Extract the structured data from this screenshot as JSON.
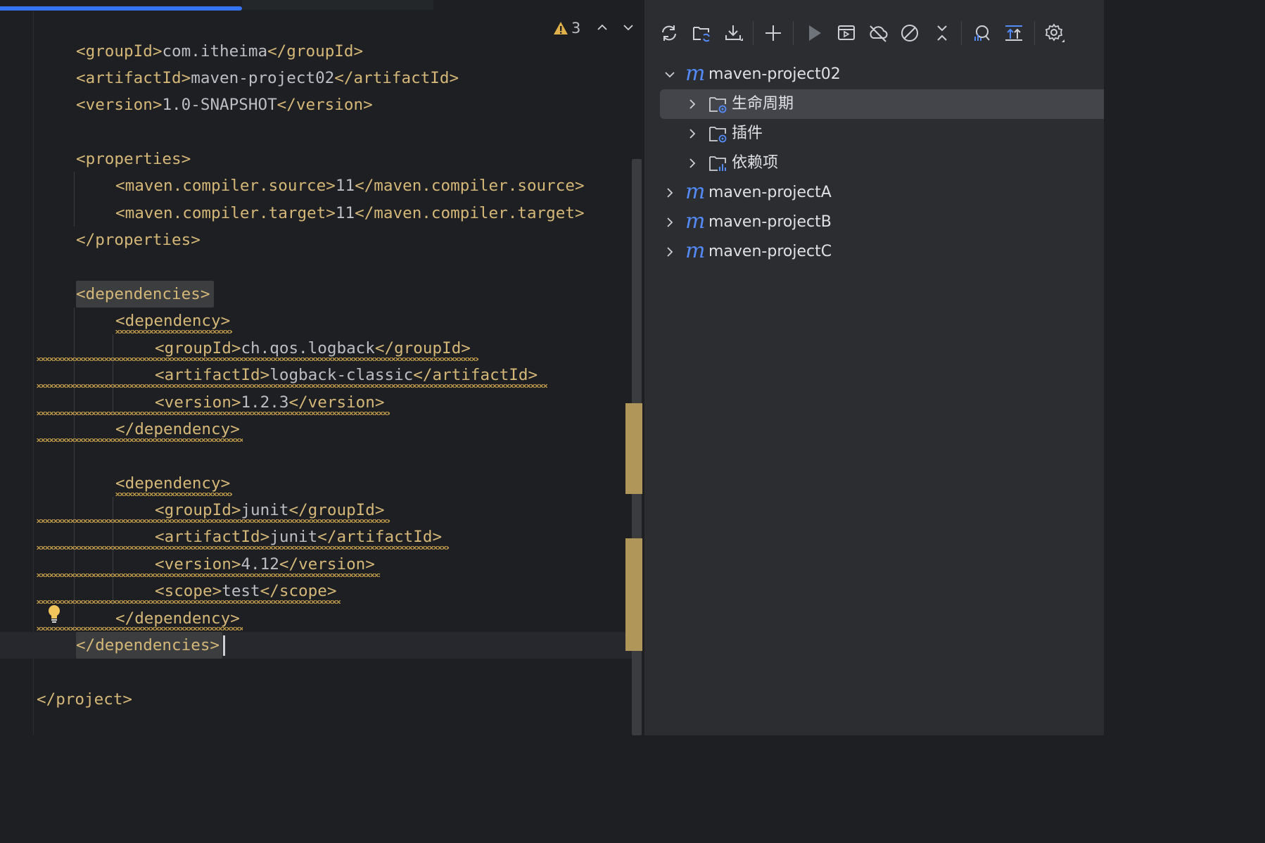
{
  "editor": {
    "lines": [
      {
        "id": "l1",
        "parts": [
          [
            "tag",
            "<groupId>"
          ],
          [
            "txt",
            "com.itheima"
          ],
          [
            "tag",
            "</groupId>"
          ]
        ]
      },
      {
        "id": "l2",
        "parts": [
          [
            "tag",
            "<artifactId>"
          ],
          [
            "txt",
            "maven-project02"
          ],
          [
            "tag",
            "</artifactId>"
          ]
        ]
      },
      {
        "id": "l3",
        "parts": [
          [
            "tag",
            "<version>"
          ],
          [
            "txt",
            "1.0-SNAPSHOT"
          ],
          [
            "tag",
            "</version>"
          ]
        ]
      },
      {
        "id": "l5",
        "parts": [
          [
            "tag",
            "<properties>"
          ]
        ]
      },
      {
        "id": "l6",
        "parts": [
          [
            "tag",
            "<maven.compiler.source>"
          ],
          [
            "txt",
            "11"
          ],
          [
            "tag",
            "</maven.compiler.source>"
          ]
        ]
      },
      {
        "id": "l7",
        "parts": [
          [
            "tag",
            "<maven.compiler.target>"
          ],
          [
            "txt",
            "11"
          ],
          [
            "tag",
            "</maven.compiler.target>"
          ]
        ]
      },
      {
        "id": "l8",
        "parts": [
          [
            "tag",
            "</properties>"
          ]
        ]
      },
      {
        "id": "l10",
        "parts": [
          [
            "tag",
            "<dependencies>"
          ]
        ]
      },
      {
        "id": "l11",
        "parts": [
          [
            "tag",
            "<dependency>"
          ]
        ]
      },
      {
        "id": "l12",
        "parts": [
          [
            "tag",
            "<groupId>"
          ],
          [
            "txt",
            "ch.qos.logback"
          ],
          [
            "tag",
            "</groupId>"
          ]
        ]
      },
      {
        "id": "l13",
        "parts": [
          [
            "tag",
            "<artifactId>"
          ],
          [
            "txt",
            "logback-classic"
          ],
          [
            "tag",
            "</artifactId>"
          ]
        ]
      },
      {
        "id": "l14",
        "parts": [
          [
            "tag",
            "<version>"
          ],
          [
            "txt",
            "1.2.3"
          ],
          [
            "tag",
            "</version>"
          ]
        ]
      },
      {
        "id": "l15",
        "parts": [
          [
            "tag",
            "</dependency>"
          ]
        ]
      },
      {
        "id": "l17",
        "parts": [
          [
            "tag",
            "<dependency>"
          ]
        ]
      },
      {
        "id": "l18",
        "parts": [
          [
            "tag",
            "<groupId>"
          ],
          [
            "txt",
            "junit"
          ],
          [
            "tag",
            "</groupId>"
          ]
        ]
      },
      {
        "id": "l19",
        "parts": [
          [
            "tag",
            "<artifactId>"
          ],
          [
            "txt",
            "junit"
          ],
          [
            "tag",
            "</artifactId>"
          ]
        ]
      },
      {
        "id": "l20",
        "parts": [
          [
            "tag",
            "<version>"
          ],
          [
            "txt",
            "4.12"
          ],
          [
            "tag",
            "</version>"
          ]
        ]
      },
      {
        "id": "l21",
        "parts": [
          [
            "tag",
            "<scope>"
          ],
          [
            "txt",
            "test"
          ],
          [
            "tag",
            "</scope>"
          ]
        ]
      },
      {
        "id": "l22",
        "parts": [
          [
            "tag",
            "</dependency>"
          ]
        ]
      },
      {
        "id": "l23",
        "parts": [
          [
            "tag",
            "</dependencies>"
          ]
        ]
      },
      {
        "id": "l25",
        "parts": [
          [
            "tag",
            "</project>"
          ]
        ]
      }
    ],
    "warnings_count": "3"
  },
  "maven_panel": {
    "toolbar_icons": [
      "reload-icon",
      "add-maven-project-icon",
      "download-icon",
      "plus-icon",
      "run-icon",
      "execute-goal-icon",
      "offline-icon",
      "skip-tests-icon",
      "collapse-icon",
      "analyze-dependencies-icon",
      "show-dependencies-icon",
      "settings-icon"
    ],
    "tree": {
      "root": {
        "label": "maven-project02"
      },
      "children": [
        {
          "label": "生命周期"
        },
        {
          "label": "插件"
        },
        {
          "label": "依赖项"
        }
      ],
      "siblings": [
        {
          "label": "maven-projectA"
        },
        {
          "label": "maven-projectB"
        },
        {
          "label": "maven-projectC"
        }
      ]
    }
  },
  "colors": {
    "editor_bg": "#1e1f22",
    "panel_bg": "#2b2d30",
    "tag": "#d5b778",
    "text": "#bcbec4",
    "accent": "#3574f0",
    "maven_m": "#548af7",
    "warning": "#c9a24e"
  }
}
